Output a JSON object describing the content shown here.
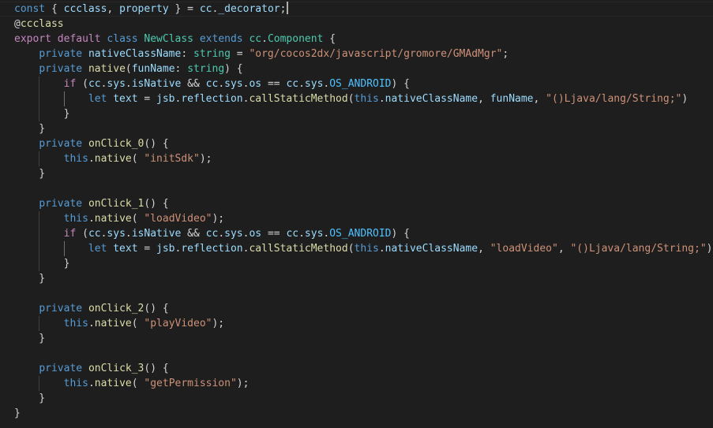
{
  "editor": {
    "cursor_line": 1,
    "lines": [
      [
        {
          "t": "const",
          "c": "kw"
        },
        {
          "t": " { ",
          "c": "pun"
        },
        {
          "t": "ccclass",
          "c": "var"
        },
        {
          "t": ", ",
          "c": "pun"
        },
        {
          "t": "property",
          "c": "var"
        },
        {
          "t": " } = ",
          "c": "pun"
        },
        {
          "t": "cc",
          "c": "var"
        },
        {
          "t": ".",
          "c": "pun"
        },
        {
          "t": "_decorator",
          "c": "var"
        },
        {
          "t": ";",
          "c": "pun"
        }
      ],
      [
        {
          "t": "@",
          "c": "pun"
        },
        {
          "t": "ccclass",
          "c": "dec"
        }
      ],
      [
        {
          "t": "export",
          "c": "kwc"
        },
        {
          "t": " ",
          "c": "pun"
        },
        {
          "t": "default",
          "c": "kwc"
        },
        {
          "t": " ",
          "c": "pun"
        },
        {
          "t": "class",
          "c": "kw"
        },
        {
          "t": " ",
          "c": "pun"
        },
        {
          "t": "NewClass",
          "c": "cls"
        },
        {
          "t": " ",
          "c": "pun"
        },
        {
          "t": "extends",
          "c": "kw"
        },
        {
          "t": " ",
          "c": "pun"
        },
        {
          "t": "cc",
          "c": "cls"
        },
        {
          "t": ".",
          "c": "pun"
        },
        {
          "t": "Component",
          "c": "cls"
        },
        {
          "t": " {",
          "c": "pun"
        }
      ],
      [
        {
          "t": "    ",
          "c": "pun"
        },
        {
          "t": "private",
          "c": "kw"
        },
        {
          "t": " ",
          "c": "pun"
        },
        {
          "t": "nativeClassName",
          "c": "var"
        },
        {
          "t": ": ",
          "c": "pun"
        },
        {
          "t": "string",
          "c": "cls"
        },
        {
          "t": " = ",
          "c": "pun"
        },
        {
          "t": "\"org/cocos2dx/javascript/gromore/GMAdMgr\"",
          "c": "str"
        },
        {
          "t": ";",
          "c": "pun"
        }
      ],
      [
        {
          "t": "    ",
          "c": "pun"
        },
        {
          "t": "private",
          "c": "kw"
        },
        {
          "t": " ",
          "c": "pun"
        },
        {
          "t": "native",
          "c": "fn"
        },
        {
          "t": "(",
          "c": "pun"
        },
        {
          "t": "funName",
          "c": "var"
        },
        {
          "t": ": ",
          "c": "pun"
        },
        {
          "t": "string",
          "c": "cls"
        },
        {
          "t": ") {",
          "c": "pun"
        }
      ],
      [
        {
          "t": "        ",
          "c": "pun"
        },
        {
          "t": "if",
          "c": "kwc"
        },
        {
          "t": " (",
          "c": "pun"
        },
        {
          "t": "cc",
          "c": "var"
        },
        {
          "t": ".",
          "c": "pun"
        },
        {
          "t": "sys",
          "c": "var"
        },
        {
          "t": ".",
          "c": "pun"
        },
        {
          "t": "isNative",
          "c": "var"
        },
        {
          "t": " && ",
          "c": "pun"
        },
        {
          "t": "cc",
          "c": "var"
        },
        {
          "t": ".",
          "c": "pun"
        },
        {
          "t": "sys",
          "c": "var"
        },
        {
          "t": ".",
          "c": "pun"
        },
        {
          "t": "os",
          "c": "var"
        },
        {
          "t": " == ",
          "c": "pun"
        },
        {
          "t": "cc",
          "c": "var"
        },
        {
          "t": ".",
          "c": "pun"
        },
        {
          "t": "sys",
          "c": "var"
        },
        {
          "t": ".",
          "c": "pun"
        },
        {
          "t": "OS_ANDROID",
          "c": "con"
        },
        {
          "t": ") {",
          "c": "pun"
        }
      ],
      [
        {
          "t": "            ",
          "c": "pun"
        },
        {
          "t": "let",
          "c": "kw"
        },
        {
          "t": " ",
          "c": "pun"
        },
        {
          "t": "text",
          "c": "var"
        },
        {
          "t": " = ",
          "c": "pun"
        },
        {
          "t": "jsb",
          "c": "var"
        },
        {
          "t": ".",
          "c": "pun"
        },
        {
          "t": "reflection",
          "c": "var"
        },
        {
          "t": ".",
          "c": "pun"
        },
        {
          "t": "callStaticMethod",
          "c": "fn"
        },
        {
          "t": "(",
          "c": "pun"
        },
        {
          "t": "this",
          "c": "kw"
        },
        {
          "t": ".",
          "c": "pun"
        },
        {
          "t": "nativeClassName",
          "c": "var"
        },
        {
          "t": ", ",
          "c": "pun"
        },
        {
          "t": "funName",
          "c": "var"
        },
        {
          "t": ", ",
          "c": "pun"
        },
        {
          "t": "\"()Ljava/lang/String;\"",
          "c": "str"
        },
        {
          "t": ")",
          "c": "pun"
        }
      ],
      [
        {
          "t": "        }",
          "c": "pun"
        }
      ],
      [
        {
          "t": "    }",
          "c": "pun"
        }
      ],
      [
        {
          "t": "    ",
          "c": "pun"
        },
        {
          "t": "private",
          "c": "kw"
        },
        {
          "t": " ",
          "c": "pun"
        },
        {
          "t": "onClick_0",
          "c": "fn"
        },
        {
          "t": "() {",
          "c": "pun"
        }
      ],
      [
        {
          "t": "        ",
          "c": "pun"
        },
        {
          "t": "this",
          "c": "kw"
        },
        {
          "t": ".",
          "c": "pun"
        },
        {
          "t": "native",
          "c": "fn"
        },
        {
          "t": "( ",
          "c": "pun"
        },
        {
          "t": "\"initSdk\"",
          "c": "str"
        },
        {
          "t": ");",
          "c": "pun"
        }
      ],
      [
        {
          "t": "    }",
          "c": "pun"
        }
      ],
      [],
      [
        {
          "t": "    ",
          "c": "pun"
        },
        {
          "t": "private",
          "c": "kw"
        },
        {
          "t": " ",
          "c": "pun"
        },
        {
          "t": "onClick_1",
          "c": "fn"
        },
        {
          "t": "() {",
          "c": "pun"
        }
      ],
      [
        {
          "t": "        ",
          "c": "pun"
        },
        {
          "t": "this",
          "c": "kw"
        },
        {
          "t": ".",
          "c": "pun"
        },
        {
          "t": "native",
          "c": "fn"
        },
        {
          "t": "( ",
          "c": "pun"
        },
        {
          "t": "\"loadVideo\"",
          "c": "str"
        },
        {
          "t": ");",
          "c": "pun"
        }
      ],
      [
        {
          "t": "        ",
          "c": "pun"
        },
        {
          "t": "if",
          "c": "kwc"
        },
        {
          "t": " (",
          "c": "pun"
        },
        {
          "t": "cc",
          "c": "var"
        },
        {
          "t": ".",
          "c": "pun"
        },
        {
          "t": "sys",
          "c": "var"
        },
        {
          "t": ".",
          "c": "pun"
        },
        {
          "t": "isNative",
          "c": "var"
        },
        {
          "t": " && ",
          "c": "pun"
        },
        {
          "t": "cc",
          "c": "var"
        },
        {
          "t": ".",
          "c": "pun"
        },
        {
          "t": "sys",
          "c": "var"
        },
        {
          "t": ".",
          "c": "pun"
        },
        {
          "t": "os",
          "c": "var"
        },
        {
          "t": " == ",
          "c": "pun"
        },
        {
          "t": "cc",
          "c": "var"
        },
        {
          "t": ".",
          "c": "pun"
        },
        {
          "t": "sys",
          "c": "var"
        },
        {
          "t": ".",
          "c": "pun"
        },
        {
          "t": "OS_ANDROID",
          "c": "con"
        },
        {
          "t": ") {",
          "c": "pun"
        }
      ],
      [
        {
          "t": "            ",
          "c": "pun"
        },
        {
          "t": "let",
          "c": "kw"
        },
        {
          "t": " ",
          "c": "pun"
        },
        {
          "t": "text",
          "c": "var"
        },
        {
          "t": " = ",
          "c": "pun"
        },
        {
          "t": "jsb",
          "c": "var"
        },
        {
          "t": ".",
          "c": "pun"
        },
        {
          "t": "reflection",
          "c": "var"
        },
        {
          "t": ".",
          "c": "pun"
        },
        {
          "t": "callStaticMethod",
          "c": "fn"
        },
        {
          "t": "(",
          "c": "pun"
        },
        {
          "t": "this",
          "c": "kw"
        },
        {
          "t": ".",
          "c": "pun"
        },
        {
          "t": "nativeClassName",
          "c": "var"
        },
        {
          "t": ", ",
          "c": "pun"
        },
        {
          "t": "\"loadVideo\"",
          "c": "str"
        },
        {
          "t": ", ",
          "c": "pun"
        },
        {
          "t": "\"()Ljava/lang/String;\"",
          "c": "str"
        },
        {
          "t": ")",
          "c": "pun"
        }
      ],
      [
        {
          "t": "        }",
          "c": "pun"
        }
      ],
      [
        {
          "t": "    }",
          "c": "pun"
        }
      ],
      [],
      [
        {
          "t": "    ",
          "c": "pun"
        },
        {
          "t": "private",
          "c": "kw"
        },
        {
          "t": " ",
          "c": "pun"
        },
        {
          "t": "onClick_2",
          "c": "fn"
        },
        {
          "t": "() {",
          "c": "pun"
        }
      ],
      [
        {
          "t": "        ",
          "c": "pun"
        },
        {
          "t": "this",
          "c": "kw"
        },
        {
          "t": ".",
          "c": "pun"
        },
        {
          "t": "native",
          "c": "fn"
        },
        {
          "t": "( ",
          "c": "pun"
        },
        {
          "t": "\"playVideo\"",
          "c": "str"
        },
        {
          "t": ");",
          "c": "pun"
        }
      ],
      [
        {
          "t": "    }",
          "c": "pun"
        }
      ],
      [],
      [
        {
          "t": "    ",
          "c": "pun"
        },
        {
          "t": "private",
          "c": "kw"
        },
        {
          "t": " ",
          "c": "pun"
        },
        {
          "t": "onClick_3",
          "c": "fn"
        },
        {
          "t": "() {",
          "c": "pun"
        }
      ],
      [
        {
          "t": "        ",
          "c": "pun"
        },
        {
          "t": "this",
          "c": "kw"
        },
        {
          "t": ".",
          "c": "pun"
        },
        {
          "t": "native",
          "c": "fn"
        },
        {
          "t": "( ",
          "c": "pun"
        },
        {
          "t": "\"getPermission\"",
          "c": "str"
        },
        {
          "t": ");",
          "c": "pun"
        }
      ],
      [
        {
          "t": "    }",
          "c": "pun"
        }
      ],
      [
        {
          "t": "}",
          "c": "pun"
        }
      ]
    ]
  },
  "colors": {
    "background": "#1e1e1e",
    "keyword": "#569cd6",
    "control_keyword": "#c586c0",
    "type": "#4ec9b0",
    "variable": "#9cdcfe",
    "function": "#dcdcaa",
    "string": "#ce9178",
    "constant": "#4fc1ff",
    "punctuation": "#d4d4d4"
  }
}
